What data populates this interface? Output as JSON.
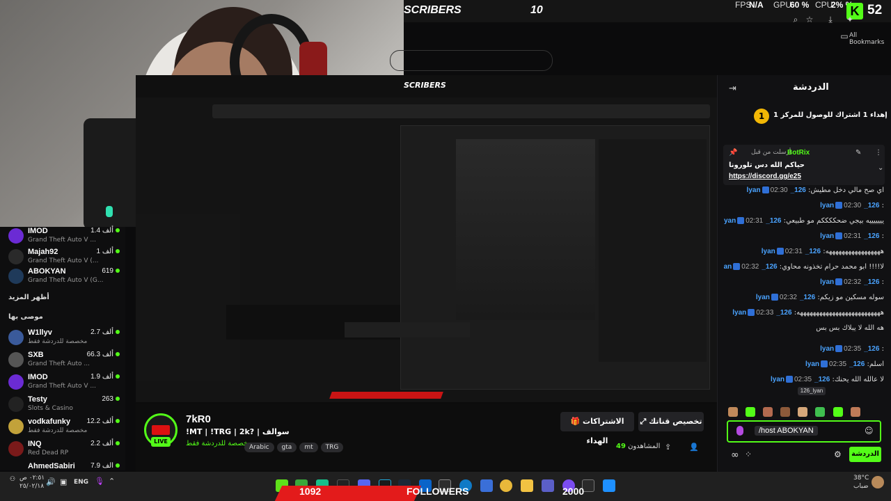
{
  "top_bar": {
    "banner_suffix": "SCRIBERS",
    "banner_value": "10",
    "fps_label": "FPS",
    "fps_value": "N/A",
    "gpu_label": "GPU",
    "gpu_value": "60 %",
    "cpu_label": "CPU",
    "cpu_value": "2% %",
    "kick_badge": "52"
  },
  "browser": {
    "all_bookmarks": "All Bookmarks"
  },
  "chat": {
    "title": "الدردشة",
    "pinned_goal": "إهداء 1 اشتراك للوصول للمركز 1 th",
    "pinned_goal_rank": "1",
    "pinned_from_label": "أرسلت من قبل",
    "pinned_user": "BotRix",
    "pinned_text": "حياكم الله دس تلورونا",
    "pinned_link": "https://discord.gg/e25",
    "messages": [
      {
        "time": "02:30",
        "user": "126_lyan",
        "text": "اي صح مالي دخل مطيش"
      },
      {
        "time": "02:30",
        "user": "126_lyan",
        "text": ""
      },
      {
        "time": "02:31",
        "user": "126_lyan",
        "text": "يييييييه بيجي ضحككككم مو طبيعي"
      },
      {
        "time": "02:31",
        "user": "126_lyan",
        "text": ""
      },
      {
        "time": "02:31",
        "user": "126_lyan",
        "text": "هههههههههههههههههه"
      },
      {
        "time": "02:32",
        "user": "126_lyan",
        "text": "لا!!!! ابو محمد حرام تخذونه محاوي"
      },
      {
        "time": "02:32",
        "user": "126_lyan",
        "text": ""
      },
      {
        "time": "02:32",
        "user": "126_lyan",
        "text": "سوله مسكين مو زيكم"
      },
      {
        "time": "02:33",
        "user": "126_lyan",
        "text": "ههههههههههههههههههههههههههه"
      },
      {
        "time": "",
        "user": "",
        "text": "هه الله لا يبلاك بس بس"
      },
      {
        "time": "02:35",
        "user": "126_lyan",
        "text": ""
      },
      {
        "time": "02:35",
        "user": "126_lyan",
        "text": "اسلم"
      },
      {
        "time": "02:35",
        "user": "126_lyan",
        "text": "لا عالله الله يحنك"
      }
    ],
    "tooltip_user": "126_lyan",
    "input_value": "/host ABOKYAN",
    "send_label": "الدردشة"
  },
  "sidebar": {
    "top_items": [
      {
        "name": "IMOD",
        "game": "Grand Theft Auto V ...",
        "count": "1.4 ألف"
      },
      {
        "name": "Majah92",
        "game": "Grand Theft Auto V (...",
        "count": "1 ألف"
      },
      {
        "name": "ABOKYAN",
        "game": "Grand Theft Auto V (G...",
        "count": "619"
      }
    ],
    "show_more": "أظهر المزيد",
    "recommended_label": "موصى بها",
    "recommended": [
      {
        "name": "W1llyv",
        "game": "مخصصة للدردشة فقط",
        "count": "2.7 ألف"
      },
      {
        "name": "SXB",
        "game": "Grand Theft Auto ...",
        "count": "66.3 ألف"
      },
      {
        "name": "IMOD",
        "game": "Grand Theft Auto V ...",
        "count": "1.9 ألف"
      },
      {
        "name": "Testy",
        "game": "Slots & Casino",
        "count": "263"
      },
      {
        "name": "vodkafunky",
        "game": "مخصصة للدردشة فقط",
        "count": "12.2 ألف"
      },
      {
        "name": "INQ",
        "game": "Red Dead RP",
        "count": "2.2 ألف"
      },
      {
        "name": "AhmedSabiri",
        "game": "",
        "count": "7.9 ألف"
      }
    ]
  },
  "channel": {
    "name": "7kR0",
    "title": "!MT | !TRG | 2k? | سوالف",
    "category": "مخصصة للدردشة فقط",
    "live": "LIVE",
    "tags": [
      "Arabic",
      "gta",
      "mt",
      "TRG"
    ],
    "gift_subs": "الاشتراكات الهداء",
    "customize": "تخصيص قناتك",
    "viewers_label": "المشاهدون",
    "viewers": "49"
  },
  "goal": {
    "current": "1092",
    "label": "FOLLOWERS",
    "target": "2000"
  },
  "taskbar": {
    "time": "٠٢:٥١ ص",
    "date": "٢٥/٠٢/١٨",
    "lang": "ENG",
    "temp": "38°C",
    "weather": "ضباب"
  },
  "colors": {
    "kick_green": "#53fc18",
    "goal_red": "#e31b1b",
    "link_blue": "#4aa3ff"
  }
}
